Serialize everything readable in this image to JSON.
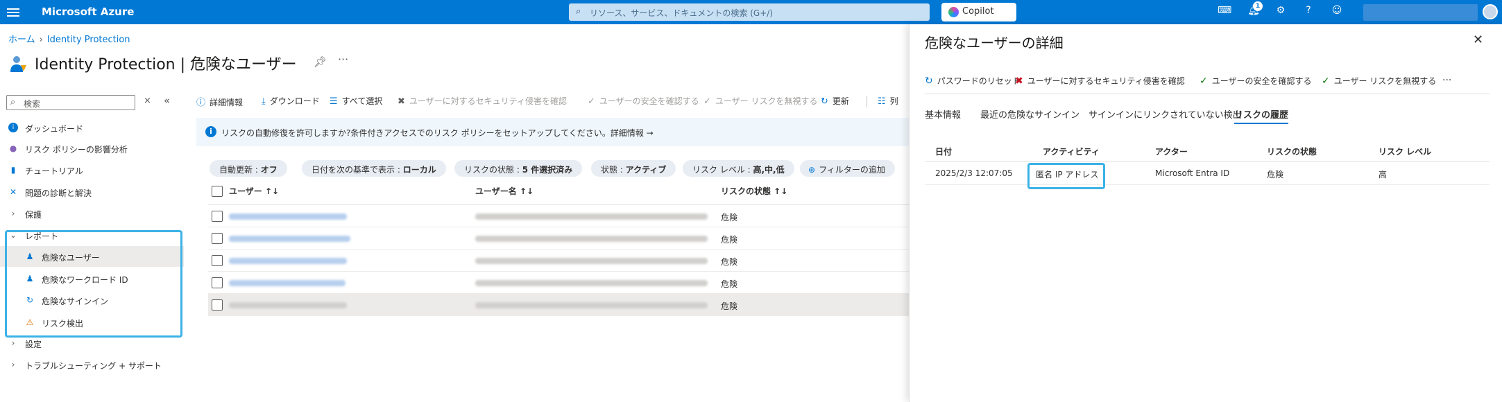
{
  "topbar": {
    "brand": "Microsoft Azure",
    "search_placeholder": "リソース、サービス、ドキュメントの検索 (G+/)",
    "copilot_label": "Copilot",
    "notification_count": "1",
    "accent_color": "#0078d4"
  },
  "breadcrumb": {
    "home": "ホーム",
    "current": "Identity Protection"
  },
  "page": {
    "title": "Identity Protection | 危険なユーザー"
  },
  "leftnav": {
    "search_placeholder": "検索",
    "items": [
      {
        "label": "ダッシュボード",
        "icon": "info-icon"
      },
      {
        "label": "リスク ポリシーの影響分析",
        "icon": "bulb-icon"
      },
      {
        "label": "チュートリアル",
        "icon": "book-icon"
      },
      {
        "label": "問題の診断と解決",
        "icon": "wrench-icon"
      },
      {
        "label": "保護",
        "icon": "chevron-right-icon"
      },
      {
        "label": "レポート",
        "icon": "chevron-down-icon"
      },
      {
        "label": "危険なユーザー",
        "icon": "risky-user-icon"
      },
      {
        "label": "危険なワークロード ID",
        "icon": "workload-icon"
      },
      {
        "label": "危険なサインイン",
        "icon": "signin-icon"
      },
      {
        "label": "リスク検出",
        "icon": "warning-icon"
      },
      {
        "label": "設定",
        "icon": "chevron-right-icon"
      },
      {
        "label": "トラブルシューティング + サポート",
        "icon": "chevron-right-icon"
      }
    ]
  },
  "toolbar": {
    "details": "詳細情報",
    "download": "ダウンロード",
    "select_all": "すべて選択",
    "confirm_compromised": "ユーザーに対するセキュリティ侵害を確認",
    "confirm_safe": "ユーザーの安全を確認する",
    "dismiss_risk": "ユーザー リスクを無視する",
    "refresh": "更新",
    "columns": "列"
  },
  "infobar": {
    "text": "リスクの自動修復を許可しますか?条件付きアクセスでのリスク ポリシーをセットアップしてください。詳細情報 →"
  },
  "filters": [
    {
      "label": "自動更新 : ",
      "value": "オフ"
    },
    {
      "label": "日付を次の基準で表示 : ",
      "value": "ローカル"
    },
    {
      "label": "リスクの状態 : ",
      "value": "5 件選択済み"
    },
    {
      "label": "状態 : ",
      "value": "アクティブ"
    },
    {
      "label": "リスク レベル : ",
      "value": "高,中,低"
    },
    {
      "label": "フィルターの追加",
      "value": ""
    }
  ],
  "grid": {
    "columns": [
      "ユーザー ↑↓",
      "ユーザー名 ↑↓",
      "リスクの状態 ↑↓"
    ],
    "rows": [
      {
        "risk_state": "危険"
      },
      {
        "risk_state": "危険"
      },
      {
        "risk_state": "危険"
      },
      {
        "risk_state": "危険"
      },
      {
        "risk_state": "危険"
      }
    ]
  },
  "panel": {
    "title": "危険なユーザーの詳細",
    "actions": {
      "reset_password": "パスワードのリセット",
      "confirm_compromised": "ユーザーに対するセキュリティ侵害を確認",
      "confirm_safe": "ユーザーの安全を確認する",
      "dismiss_risk": "ユーザー リスクを無視する"
    },
    "tabs": [
      "基本情報",
      "最近の危険なサインイン",
      "サインインにリンクされていない検出",
      "リスクの履歴"
    ],
    "history": {
      "columns": [
        "日付",
        "アクティビティ",
        "アクター",
        "リスクの状態",
        "リスク レベル"
      ],
      "rows": [
        {
          "date": "2025/2/3 12:07:05",
          "activity": "匿名 IP アドレス",
          "actor": "Microsoft Entra ID",
          "state": "危険",
          "level": "高"
        }
      ]
    }
  }
}
